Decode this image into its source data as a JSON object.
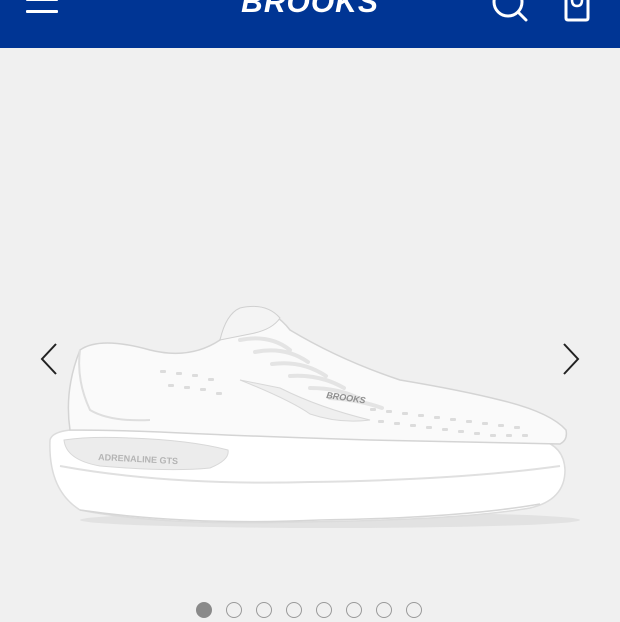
{
  "header": {
    "brand": "BROOKS",
    "background": "#003594",
    "icons": [
      "menu-icon",
      "search-icon",
      "bag-icon"
    ]
  },
  "product": {
    "shoe_logo_text": "BROOKS",
    "shoe_model_text": "ADRENALINE GTS",
    "shoe_color": "white"
  },
  "carousel": {
    "slide_count": 8,
    "active_index": 0,
    "dot_labels": [
      "1",
      "2",
      "3",
      "4",
      "5",
      "6",
      "7",
      "8"
    ]
  }
}
